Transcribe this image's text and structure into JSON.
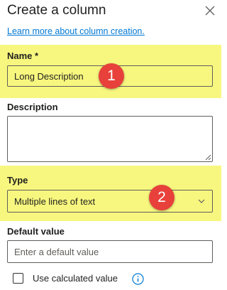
{
  "panel": {
    "title": "Create a column",
    "learn_more": "Learn more about column creation."
  },
  "name_field": {
    "label": "Name *",
    "value": "Long Description"
  },
  "description_field": {
    "label": "Description",
    "value": ""
  },
  "type_field": {
    "label": "Type",
    "selected": "Multiple lines of text"
  },
  "default_field": {
    "label": "Default value",
    "placeholder": "Enter a default value"
  },
  "calculated": {
    "label": "Use calculated value",
    "checked": false
  },
  "annotations": {
    "step1": "1",
    "step2": "2"
  },
  "colors": {
    "highlight": "#f7f77f",
    "badge": "#e8403b",
    "link": "#0078d4"
  },
  "icons": [
    "close-icon",
    "chevron-down-icon",
    "info-icon",
    "resize-handle-icon"
  ]
}
